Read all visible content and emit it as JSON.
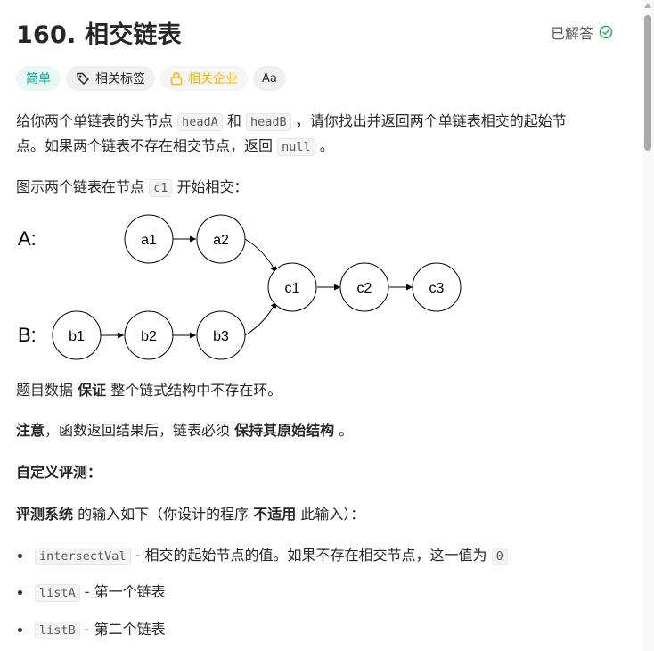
{
  "problem": {
    "title": "160. 相交链表",
    "status_label": "已解答",
    "colors": {
      "easy": "#00af9b",
      "company": "#ffb700",
      "solved": "#2db55d"
    }
  },
  "tags": {
    "difficulty": "简单",
    "related_tags": "相关标签",
    "related_companies": "相关企业",
    "font_icon": "Aa"
  },
  "description": {
    "p1_a": "给你两个单链表的头节点",
    "p1_code1": "headA",
    "p1_b": "和",
    "p1_code2": "headB",
    "p1_c": "，请你找出并返回两个单链表相交的起始节",
    "p1_line2_a": "点。如果两个链表不存在相交节点，返回",
    "p1_code3": "null",
    "p1_line2_b": "。",
    "p2_a": "图示两个链表在节点",
    "p2_code": "c1",
    "p2_b": "开始相交：",
    "p3_a": "题目数据",
    "p3_bold": "保证",
    "p3_b": "整个链式结构中不存在环。",
    "p4_bold1": "注意",
    "p4_a": "，函数返回结果后，链表必须",
    "p4_bold2": "保持其原始结构",
    "p4_b": "。",
    "p5_bold": "自定义评测：",
    "p6_bold1": "评测系统",
    "p6_a": "的输入如下（你设计的程序",
    "p6_bold2": "不适用",
    "p6_b": "此输入）："
  },
  "diagram": {
    "label_a": "A:",
    "label_b": "B:",
    "nodes": [
      "a1",
      "a2",
      "c1",
      "c2",
      "c3",
      "b1",
      "b2",
      "b3"
    ]
  },
  "bullets": [
    {
      "code": "intersectVal",
      "text": "- 相交的起始节点的值。如果不存在相交节点，这一值为",
      "code2": "0"
    },
    {
      "code": "listA",
      "text": "- 第一个链表"
    },
    {
      "code": "listB",
      "text": "- 第二个链表"
    }
  ]
}
